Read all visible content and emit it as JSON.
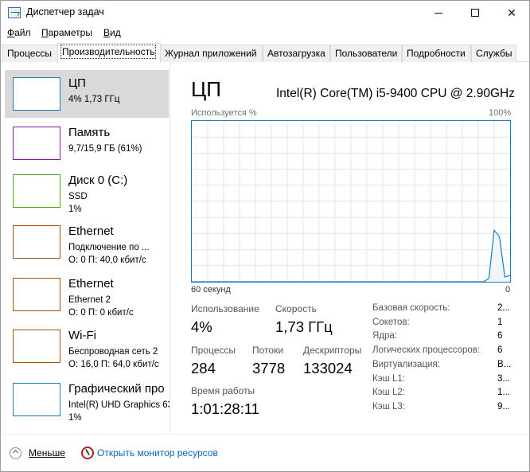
{
  "window": {
    "title": "Диспетчер задач"
  },
  "menu": [
    "Файл",
    "Параметры",
    "Вид"
  ],
  "tabs": [
    "Процессы",
    "Производительность",
    "Журнал приложений",
    "Автозагрузка",
    "Пользователи",
    "Подробности",
    "Службы"
  ],
  "active_tab": "Производительность",
  "sidebar": {
    "items": [
      {
        "name": "ЦП",
        "lines": [
          "4% 1,73 ГГц"
        ],
        "color": "#1a7bbf"
      },
      {
        "name": "Память",
        "lines": [
          "9,7/15,9 ГБ (61%)"
        ],
        "color": "#8b12ae"
      },
      {
        "name": "Диск 0 (C:)",
        "lines": [
          "SSD",
          "1%"
        ],
        "color": "#4da60c"
      },
      {
        "name": "Ethernet",
        "lines": [
          "Подключение по ...",
          "О: 0 П: 40,0 кбит/с"
        ],
        "color": "#a74f01"
      },
      {
        "name": "Ethernet",
        "lines": [
          "Ethernet 2",
          "О: 0 П: 0 кбит/с"
        ],
        "color": "#a74f01"
      },
      {
        "name": "Wi-Fi",
        "lines": [
          "Беспроводная сеть 2",
          "О: 16,0 П: 64,0 кбит/с"
        ],
        "color": "#a74f01"
      },
      {
        "name": "Графический про",
        "lines": [
          "Intel(R) UHD Graphics 63",
          "1%"
        ],
        "color": "#1a7bbf"
      }
    ]
  },
  "cpu": {
    "title": "ЦП",
    "model": "Intel(R) Core(TM) i5-9400 CPU @ 2.90GHz",
    "graph_label": "Используется %",
    "graph_max": "100%",
    "x_left": "60 секунд",
    "x_right": "0",
    "history_percent": [
      0,
      0,
      0,
      0,
      0,
      0,
      0,
      0,
      0,
      0,
      0,
      0,
      0,
      0,
      0,
      0,
      0,
      0,
      0,
      0,
      0,
      0,
      0,
      0,
      0,
      0,
      0,
      0,
      0,
      0,
      0,
      0,
      0,
      0,
      0,
      0,
      0,
      0,
      0,
      0,
      0,
      0,
      0,
      0,
      0,
      0,
      0,
      0,
      0,
      0,
      0,
      0,
      0,
      0,
      0,
      0,
      2,
      32,
      28,
      3,
      4
    ],
    "stats": {
      "usage_label": "Использование",
      "usage_value": "4%",
      "speed_label": "Скорость",
      "speed_value": "1,73 ГГц",
      "proc_label": "Процессы",
      "proc_value": "284",
      "threads_label": "Потоки",
      "threads_value": "3778",
      "handles_label": "Дескрипторы",
      "handles_value": "133024",
      "uptime_label": "Время работы",
      "uptime_value": "1:01:28:11"
    },
    "details": [
      {
        "label": "Базовая скорость:",
        "value": "2..."
      },
      {
        "label": "Сокетов:",
        "value": "1"
      },
      {
        "label": "Ядра:",
        "value": "6"
      },
      {
        "label": "Логических процессоров:",
        "value": "6"
      },
      {
        "label": "Виртуализация:",
        "value": "В..."
      },
      {
        "label": "Кэш L1:",
        "value": "3..."
      },
      {
        "label": "Кэш L2:",
        "value": "1..."
      },
      {
        "label": "Кэш L3:",
        "value": "9..."
      }
    ]
  },
  "footer": {
    "less": "Меньше",
    "monitor": "Открыть монитор ресурсов"
  }
}
